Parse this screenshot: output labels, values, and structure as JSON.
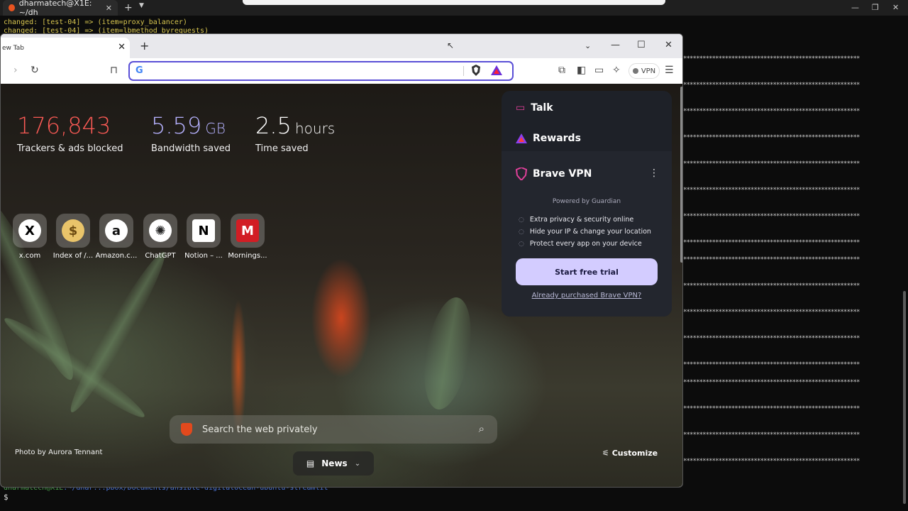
{
  "terminal": {
    "tab_title": "dharmatech@X1E: ~/dh",
    "lines": [
      "changed: [test-04] => (item=proxy_balancer)",
      "changed: [test-04] => (item=lbmethod_byrequests)"
    ],
    "bottom_user": "dharmatech@X1E",
    "bottom_path": ":~/dhar...pbox/Documents/ansible-digitalocean-ubuntu-streamlit",
    "prompt": "$",
    "stars": "*******************************************************"
  },
  "browser": {
    "tab_title": "ew Tab",
    "vpn_label": "VPN"
  },
  "stats": {
    "trackers": {
      "value": "176,843",
      "label": "Trackers & ads blocked",
      "color": "#fb5a55"
    },
    "bandwidth": {
      "value": "5.59",
      "unit": "GB",
      "label": "Bandwidth saved",
      "color": "#b6b2ff"
    },
    "time": {
      "value": "2.5",
      "unit": "hours",
      "label": "Time saved"
    }
  },
  "top_sites": [
    {
      "label": "x.com",
      "glyph": "X",
      "icon": "x-icon"
    },
    {
      "label": "Index of /...",
      "glyph": "$",
      "icon": "money-bag-icon"
    },
    {
      "label": "Amazon.c...",
      "glyph": "a",
      "icon": "amazon-icon"
    },
    {
      "label": "ChatGPT",
      "glyph": "✺",
      "icon": "chatgpt-icon"
    },
    {
      "label": "Notion – ...",
      "glyph": "N",
      "icon": "notion-icon"
    },
    {
      "label": "Mornings...",
      "glyph": "M",
      "icon": "mornings-icon"
    }
  ],
  "panel": {
    "talk": "Talk",
    "rewards": "Rewards",
    "vpn_title": "Brave VPN",
    "powered_by": "Powered by",
    "guardian": "Guardian",
    "features": [
      "Extra privacy & security online",
      "Hide your IP & change your location",
      "Protect every app on your device"
    ],
    "trial_button": "Start free trial",
    "already": "Already purchased Brave VPN?"
  },
  "search": {
    "placeholder": "Search the web privately"
  },
  "footer": {
    "photo_credit": "Photo by Aurora Tennant",
    "customize": "Customize",
    "news": "News"
  }
}
